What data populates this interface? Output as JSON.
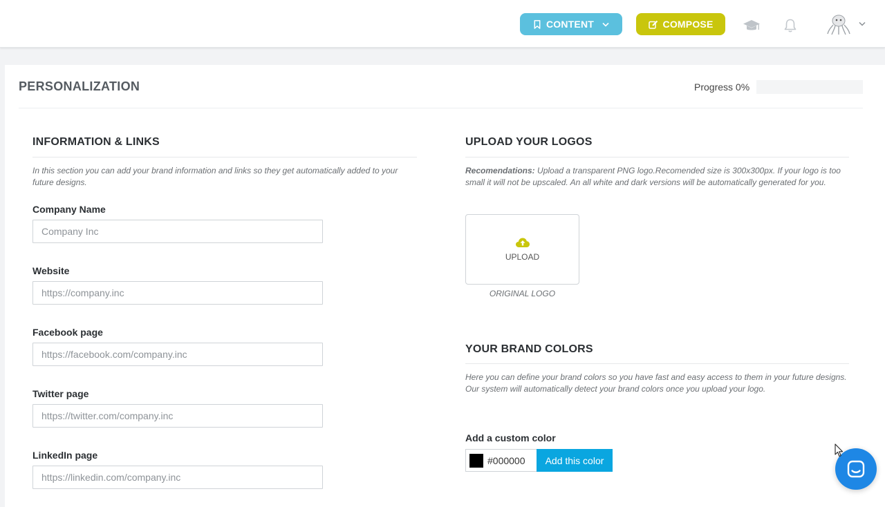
{
  "header": {
    "content_button": "CONTENT",
    "compose_button": "COMPOSE",
    "content_color": "#5bc0de",
    "compose_color": "#c9c60c",
    "icons": [
      "bookmark-icon",
      "chevron-down-icon",
      "edit-icon",
      "graduation-cap-icon",
      "bell-icon",
      "avatar",
      "chevron-down-icon"
    ]
  },
  "page": {
    "title": "PERSONALIZATION",
    "progress_label": "Progress 0%",
    "progress_value": 0
  },
  "info": {
    "title": "INFORMATION & LINKS",
    "note": "In this section you can add your brand information and links so they get automatically added to your future designs.",
    "fields": [
      {
        "label": "Company Name",
        "placeholder": "Company Inc",
        "value": ""
      },
      {
        "label": "Website",
        "placeholder": "https://company.inc",
        "value": ""
      },
      {
        "label": "Facebook page",
        "placeholder": "https://facebook.com/company.inc",
        "value": ""
      },
      {
        "label": "Twitter page",
        "placeholder": "https://twitter.com/company.inc",
        "value": ""
      },
      {
        "label": "LinkedIn page",
        "placeholder": "https://linkedin.com/company.inc",
        "value": ""
      }
    ]
  },
  "logos": {
    "title": "UPLOAD YOUR LOGOS",
    "note_bold": "Recomendations:",
    "note_text": " Upload a transparent PNG logo.Recomended size is 300x300px. If your logo is too small it will not be upscaled. An all white and dark versions will be automatically generated for you.",
    "upload_label": "UPLOAD",
    "caption": "ORIGINAL LOGO",
    "upload_icon_color": "#c9c60c"
  },
  "colors": {
    "title": "YOUR BRAND COLORS",
    "note": "Here you can define your brand colors so you have fast and easy access to them in your future designs. Our system will automatically detect your brand colors once you upload your logo.",
    "custom_label": "Add a custom color",
    "custom_value": "#000000",
    "add_button": "Add this color",
    "add_button_color": "#0aa6e0"
  },
  "chat": {
    "launcher_color": "#1e87e5"
  }
}
